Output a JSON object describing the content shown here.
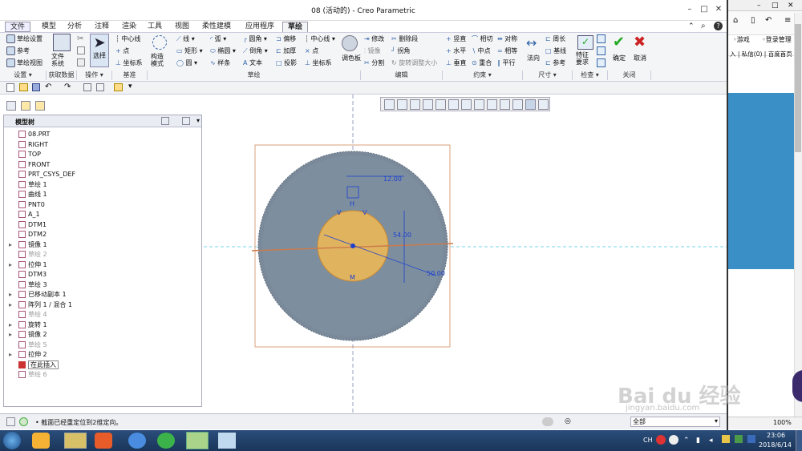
{
  "window": {
    "title": "08 (活动的) - Creo Parametric",
    "help": "?"
  },
  "menu": {
    "file": "文件",
    "tabs": [
      "模型",
      "分析",
      "注释",
      "渲染",
      "工具",
      "视图",
      "柔性建模",
      "应用程序",
      "草绘"
    ]
  },
  "ribbon": {
    "setup": {
      "sketch_setup": "草绘设置",
      "reference": "参考",
      "sketch_view": "草绘视图",
      "group": "设置"
    },
    "get_data": {
      "file_system": "文件\n系统",
      "group": "获取数据"
    },
    "operations": {
      "select": "选择",
      "group": "操作"
    },
    "datum": {
      "centerline": "中心线",
      "point": "点",
      "csys": "坐标系",
      "group": "基准"
    },
    "sketch": {
      "construction": "构造\n模式",
      "line": "线",
      "arc": "弧",
      "rectangle": "矩形",
      "ellipse": "椭圆",
      "circle": "圆",
      "spline": "样条",
      "fillet": "圆角",
      "chamfer": "倒角",
      "text": "文本",
      "offset": "偏移",
      "thicken": "加厚",
      "project": "投影",
      "centerline": "中心线",
      "point": "点",
      "csys": "坐标系",
      "palette": "调色板",
      "group": "草绘"
    },
    "editing": {
      "modify": "修改",
      "mirror": "镜像",
      "divide": "分割",
      "delete_segment": "删除段",
      "corner": "拐角",
      "rotate_resize": "旋转调整大小",
      "group": "编辑"
    },
    "constrain": {
      "vertical": "竖直",
      "horizontal": "水平",
      "perpendicular": "垂直",
      "tangent": "相切",
      "midpoint": "中点",
      "coincident": "重合",
      "symmetric": "对称",
      "equal": "相等",
      "parallel": "平行",
      "group": "约束"
    },
    "dimension": {
      "normal": "法向",
      "perimeter": "周长",
      "baseline": "基线",
      "reference": "参考",
      "group": "尺寸"
    },
    "inspect": {
      "feature_requirements": "特征\n要求",
      "group": "检查"
    },
    "close": {
      "ok": "确定",
      "cancel": "取消",
      "group": "关闭"
    }
  },
  "panel": {
    "model_tree": "模型树",
    "items": [
      {
        "label": "08.PRT",
        "dim": false
      },
      {
        "label": "RIGHT",
        "dim": false
      },
      {
        "label": "TOP",
        "dim": false
      },
      {
        "label": "FRONT",
        "dim": false
      },
      {
        "label": "PRT_CSYS_DEF",
        "dim": false
      },
      {
        "label": "草绘 1",
        "dim": false
      },
      {
        "label": "曲线 1",
        "dim": false
      },
      {
        "label": "PNT0",
        "dim": false
      },
      {
        "label": "A_1",
        "dim": false
      },
      {
        "label": "DTM1",
        "dim": false
      },
      {
        "label": "DTM2",
        "dim": false
      },
      {
        "label": "镜像 1",
        "dim": false
      },
      {
        "label": "草绘 2",
        "dim": true
      },
      {
        "label": "拉伸 1",
        "dim": false
      },
      {
        "label": "DTM3",
        "dim": false
      },
      {
        "label": "草绘 3",
        "dim": false
      },
      {
        "label": "已移动副本 1",
        "dim": false
      },
      {
        "label": "阵列 1 / 混合 1",
        "dim": false
      },
      {
        "label": "草绘 4",
        "dim": true
      },
      {
        "label": "旋转 1",
        "dim": false
      },
      {
        "label": "镜像 2",
        "dim": false
      },
      {
        "label": "草绘 5",
        "dim": true
      },
      {
        "label": "拉伸 2",
        "dim": false
      },
      {
        "label": "在此插入",
        "dim": false
      },
      {
        "label": "草绘 6",
        "dim": true
      }
    ]
  },
  "drawing": {
    "dim_h": "12.00",
    "dim_v": "54.00",
    "dim_d": "50.00",
    "lbl_v1": "V",
    "lbl_h": "H",
    "lbl_v2": "V",
    "lbl_m": "M"
  },
  "status": {
    "message": "截面已经重定位到2维定向。",
    "filter": "全部"
  },
  "browser": {
    "game": "游戏",
    "login": "登录管理",
    "nav": "入 | 私信(0) | 百度首页",
    "zoom": "100%",
    "watermark": "Bai du 经验",
    "watermark_url": "jingyan.baidu.com"
  },
  "taskbar": {
    "time": "23:06",
    "date": "2018/6/14",
    "lang": "CH"
  }
}
